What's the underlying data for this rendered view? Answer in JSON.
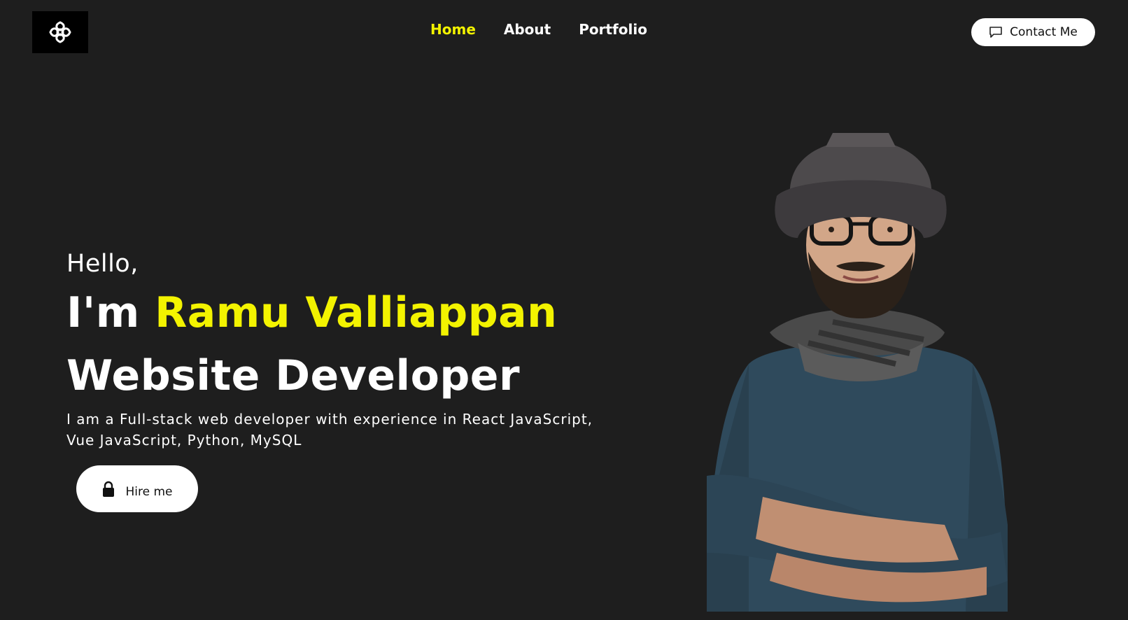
{
  "header": {
    "nav": [
      {
        "label": "Home",
        "active": true
      },
      {
        "label": "About",
        "active": false
      },
      {
        "label": "Portfolio",
        "active": false
      }
    ],
    "contact_button": {
      "label": "Contact Me",
      "icon": "chat-bubble-icon"
    }
  },
  "hero": {
    "greeting": "Hello,",
    "name_prefix": "I'm",
    "name": "Ramu Valliappan",
    "role": "Website Developer",
    "description_line1": "I am a Full-stack web developer with experience in React JavaScript,",
    "description_line2": "Vue JavaScript, Python, MySQL",
    "hire_button": {
      "label": "Hire me",
      "icon": "lock-icon"
    }
  },
  "colors": {
    "background": "#1e1e1e",
    "accent": "#f3f300",
    "text": "#ffffff"
  }
}
